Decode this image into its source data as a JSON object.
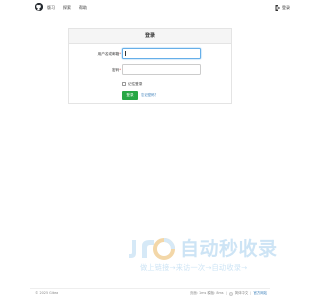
{
  "nav": {
    "links": [
      "探索",
      "帮助"
    ],
    "first_link": "版习"
  },
  "user": {
    "label": "登录"
  },
  "login": {
    "title": "登录",
    "username_label": "用户名或邮箱",
    "username_required": "*",
    "password_label": "密码",
    "password_required": "*",
    "remember_label": "记住登录",
    "submit_label": "登录",
    "forgot_label": "忘记密码？"
  },
  "watermark": {
    "title": "自动秒收录",
    "subtitle": "做上链接→来访一次→自动收录→"
  },
  "footer": {
    "copyright": "© 2025 Gitea",
    "version": "页面: 1ms 模板: 8ms",
    "language": "简体中文",
    "license": "官方网站"
  },
  "colors": {
    "accent": "#28a745",
    "link": "#337ab7",
    "watermark": "#cde4f5"
  }
}
